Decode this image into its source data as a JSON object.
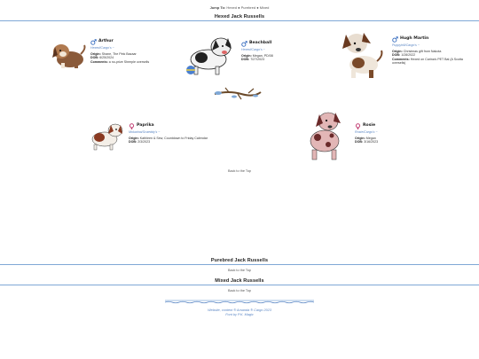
{
  "jump": {
    "label": "Jump To:",
    "link": "Hexed ● Purebred ● Mixed"
  },
  "sections": {
    "hexed": "Hexed Jack Russells",
    "purebred": "Purebred Jack Russells",
    "mixed": "Mixed Jack Russells"
  },
  "dogs": [
    {
      "name": "Arthur",
      "owner": "Hexed/Cargo's ~",
      "origin": "Shane, The Pink Bazaar",
      "dob": "6/25/2024",
      "comments": "a no-prize Sheeple oversells",
      "gender": "male"
    },
    {
      "name": "Beachball",
      "owner": "Hexed/Cargo's ~",
      "origin": "Megan, PD/08",
      "dob": "7/27/2023",
      "comments": "",
      "gender": "male"
    },
    {
      "name": "Hugh Martin",
      "owner": "Puppyhill/Cargo's ~",
      "origin": "Christmas gift from Nakota",
      "dob": "1/28/2022",
      "comments": "Hexed on Carina's PET Bal (A Scotta oversells)",
      "gender": "male"
    },
    {
      "name": "Paprika",
      "owner": "Mokarina/Scaeddy's ~",
      "origin": "Kathleen & Sew, Countdown to Friday Calendar",
      "dob": "2/3/2023",
      "comments": "",
      "gender": "female"
    },
    {
      "name": "Rosie",
      "owner": "Rosie/Cargo's ~",
      "origin": "Megan",
      "dob": "3/16/2023",
      "comments": "",
      "gender": "female"
    }
  ],
  "labels": {
    "origin": "Origin:",
    "dob": "DOB:",
    "comments": "Comments:"
  },
  "back_to_top": "Back to the Top",
  "footer": {
    "line1": "Website, content ® Amanda ® Cargo 2023",
    "line2": "Font by P.K. Magic"
  },
  "colors": {
    "rule": "#7fa8d6",
    "owner": "#5a86c4",
    "male_icon": "#3a6fc0",
    "female_icon": "#c0396f"
  }
}
